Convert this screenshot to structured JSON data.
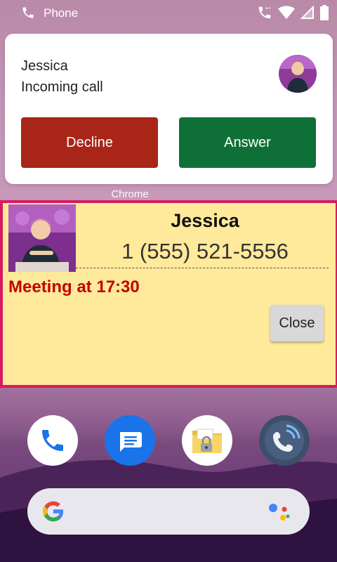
{
  "status_bar": {
    "app_label": "Phone"
  },
  "call_notification": {
    "caller_name": "Jessica",
    "status": "Incoming call",
    "decline_label": "Decline",
    "answer_label": "Answer"
  },
  "app_label": "Chrome",
  "overlay": {
    "name": "Jessica",
    "number": "1 (555) 521-5556",
    "note": "Meeting at 17:30",
    "close_label": "Close"
  },
  "colors": {
    "decline": "#a82518",
    "answer": "#0f7037",
    "overlay_border": "#d81b60",
    "overlay_bg": "#ffe99b",
    "note": "#c40000"
  },
  "dock": {
    "icons": [
      "phone-icon",
      "messages-icon",
      "folder-lock-icon",
      "call-app-icon"
    ]
  },
  "search": {
    "icons": [
      "google-logo-icon",
      "assistant-icon"
    ]
  }
}
